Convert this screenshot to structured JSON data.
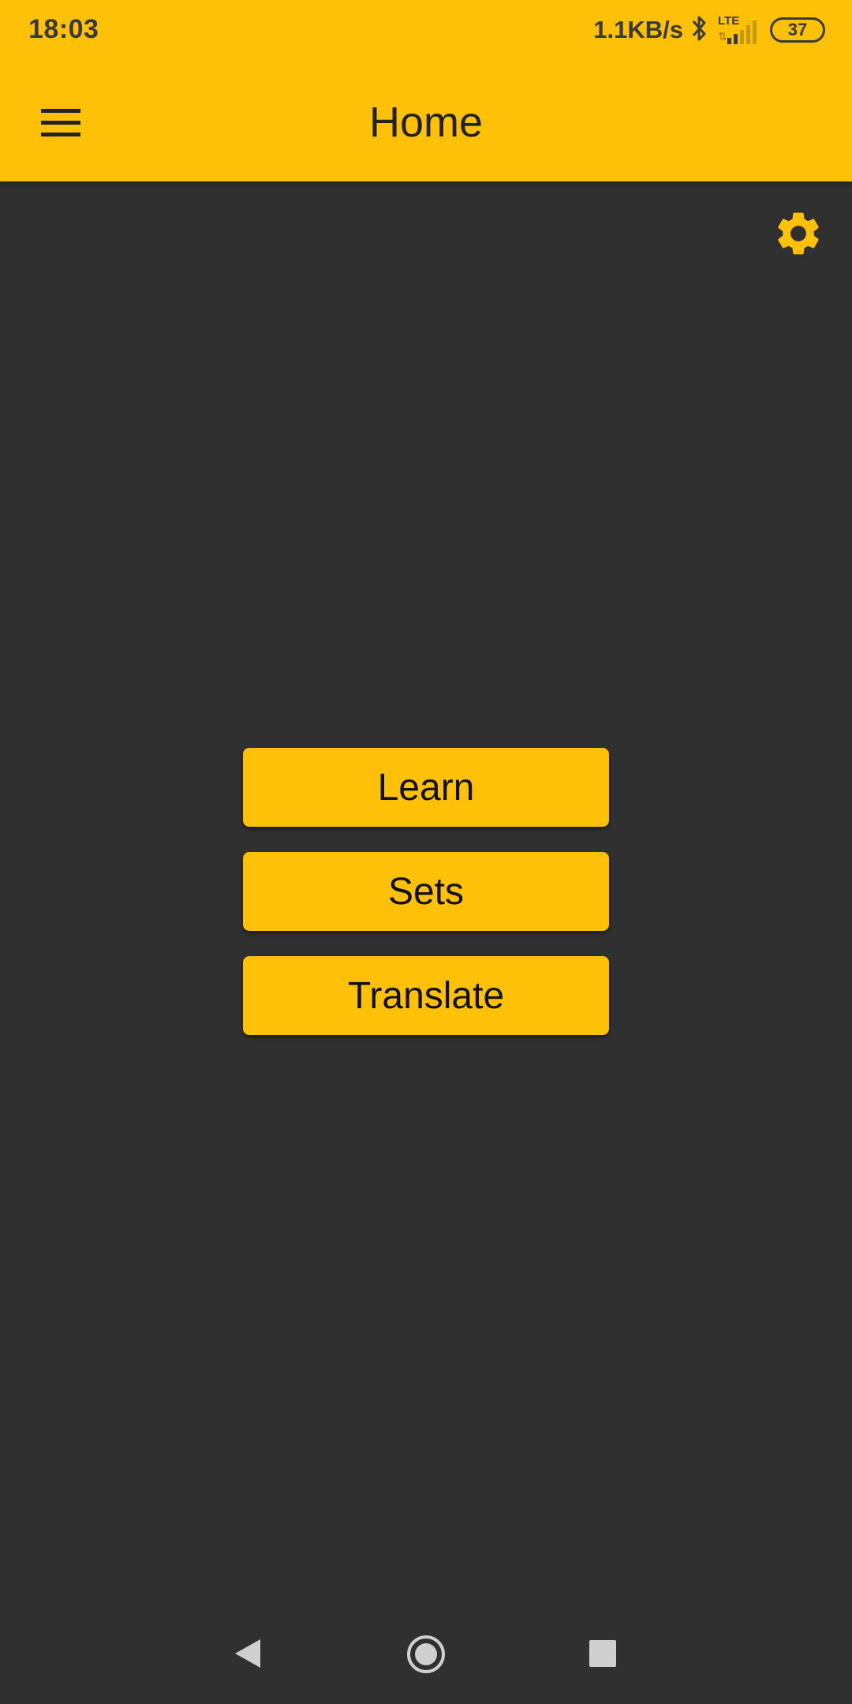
{
  "status_bar": {
    "time": "18:03",
    "net_speed": "1.1KB/s",
    "network_type": "LTE",
    "battery_level": "37",
    "icons": [
      "bluetooth-icon",
      "signal-icon",
      "battery-icon"
    ]
  },
  "app_bar": {
    "title": "Home",
    "menu_icon": "hamburger-menu-icon"
  },
  "settings": {
    "icon": "gear-icon"
  },
  "main": {
    "buttons": [
      {
        "label": "Learn"
      },
      {
        "label": "Sets"
      },
      {
        "label": "Translate"
      }
    ]
  },
  "nav_bar": {
    "icons": [
      "back-icon",
      "home-icon",
      "recent-apps-icon"
    ]
  },
  "colors": {
    "accent": "#FFC107",
    "background": "#303030",
    "text_dark": "#222222"
  }
}
